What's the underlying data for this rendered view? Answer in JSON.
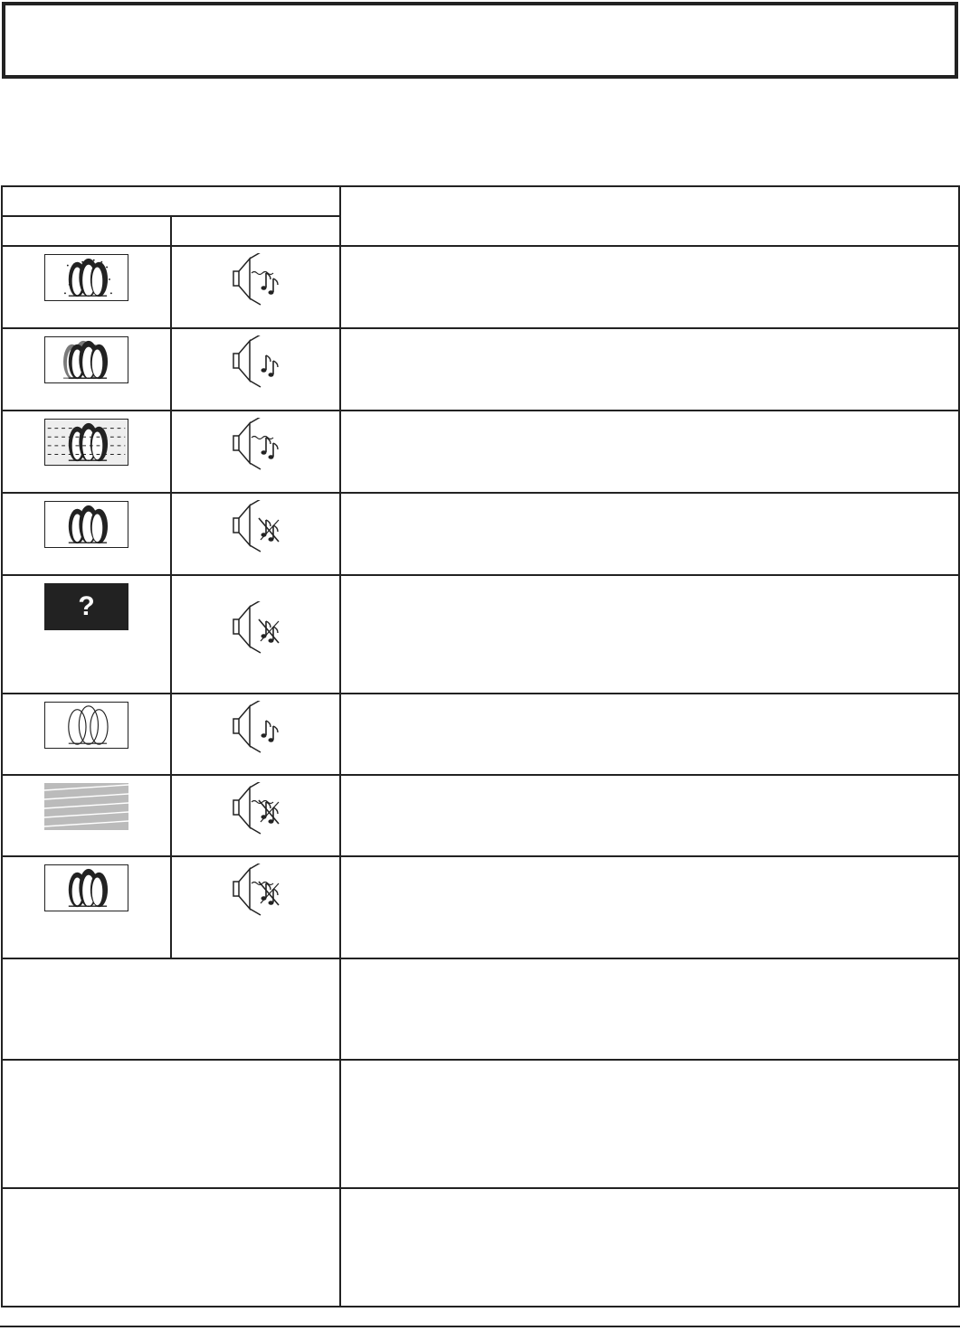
{
  "title": "",
  "subtitle": "",
  "table": {
    "header_symptoms": "",
    "header_picture": "",
    "header_sound": "",
    "header_checks": ""
  },
  "rows": [
    {
      "picture_icon": "penguins-snowy-icon",
      "sound_icon": "noisy-sound-icon",
      "text": ""
    },
    {
      "picture_icon": "penguins-ghost-icon",
      "sound_icon": "normal-sound-icon",
      "text": ""
    },
    {
      "picture_icon": "penguins-interference-icon",
      "sound_icon": "noisy-sound-icon",
      "text": ""
    },
    {
      "picture_icon": "penguins-normal-icon",
      "sound_icon": "no-sound-icon",
      "text": ""
    },
    {
      "picture_icon": "no-picture-icon",
      "picture_label": "?",
      "sound_icon": "no-sound-icon",
      "text": ""
    },
    {
      "picture_icon": "penguins-weak-color-icon",
      "sound_icon": "normal-sound-icon",
      "text": ""
    },
    {
      "picture_icon": "rolling-picture-icon",
      "sound_icon": "noisy-no-sound-icon",
      "text": ""
    },
    {
      "picture_icon": "penguins-normal-icon",
      "sound_icon": "noisy-no-sound-icon",
      "text": ""
    }
  ],
  "wide_rows": [
    {
      "symptom": "",
      "text": ""
    },
    {
      "symptom": "",
      "text": ""
    },
    {
      "symptom": "",
      "text": ""
    }
  ]
}
